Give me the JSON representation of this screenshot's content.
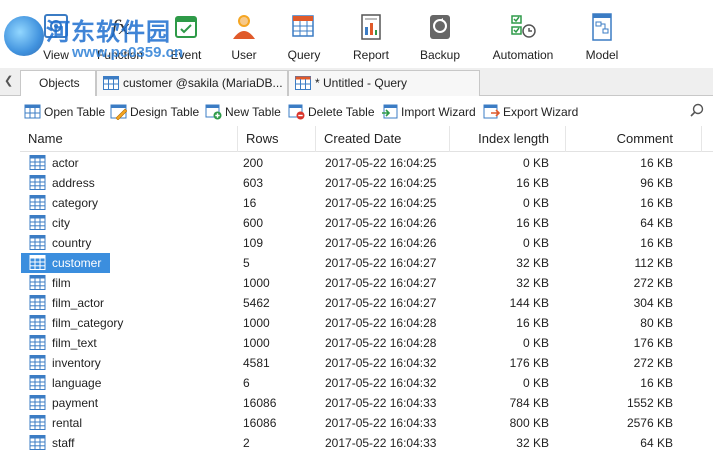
{
  "ribbon": {
    "buttons": [
      {
        "label": "View",
        "icon": "view-icon"
      },
      {
        "label": "Function",
        "icon": "function-icon"
      },
      {
        "label": "Event",
        "icon": "event-icon"
      },
      {
        "label": "User",
        "icon": "user-icon"
      },
      {
        "label": "Query",
        "icon": "query-icon"
      },
      {
        "label": "Report",
        "icon": "report-icon"
      },
      {
        "label": "Backup",
        "icon": "backup-icon"
      },
      {
        "label": "Automation",
        "icon": "automation-icon"
      },
      {
        "label": "Model",
        "icon": "model-icon"
      }
    ]
  },
  "watermark": {
    "text": "河东软件园",
    "url": "www.pc0359.cn"
  },
  "tabs": [
    {
      "label": "Objects"
    },
    {
      "label": "customer @sakila (MariaDB..."
    },
    {
      "label": "* Untitled - Query"
    }
  ],
  "toolbar": {
    "items": [
      {
        "label": "Open Table",
        "icon": "open-table-icon"
      },
      {
        "label": "Design Table",
        "icon": "design-table-icon"
      },
      {
        "label": "New Table",
        "icon": "new-table-icon"
      },
      {
        "label": "Delete Table",
        "icon": "delete-table-icon"
      },
      {
        "label": "Import Wizard",
        "icon": "import-wizard-icon"
      },
      {
        "label": "Export Wizard",
        "icon": "export-wizard-icon"
      }
    ],
    "search_icon": "search-icon"
  },
  "grid": {
    "columns": [
      "Name",
      "Rows",
      "Created Date",
      "Index length",
      "Comment"
    ],
    "selected_row": 5,
    "rows": [
      {
        "name": "actor",
        "rows": "200",
        "created": "2017-05-22 16:04:25",
        "index": "0 KB",
        "comment": "16 KB"
      },
      {
        "name": "address",
        "rows": "603",
        "created": "2017-05-22 16:04:25",
        "index": "16 KB",
        "comment": "96 KB"
      },
      {
        "name": "category",
        "rows": "16",
        "created": "2017-05-22 16:04:25",
        "index": "0 KB",
        "comment": "16 KB"
      },
      {
        "name": "city",
        "rows": "600",
        "created": "2017-05-22 16:04:26",
        "index": "16 KB",
        "comment": "64 KB"
      },
      {
        "name": "country",
        "rows": "109",
        "created": "2017-05-22 16:04:26",
        "index": "0 KB",
        "comment": "16 KB"
      },
      {
        "name": "customer",
        "rows": "5",
        "created": "2017-05-22 16:04:27",
        "index": "32 KB",
        "comment": "112 KB"
      },
      {
        "name": "film",
        "rows": "1000",
        "created": "2017-05-22 16:04:27",
        "index": "32 KB",
        "comment": "272 KB"
      },
      {
        "name": "film_actor",
        "rows": "5462",
        "created": "2017-05-22 16:04:27",
        "index": "144 KB",
        "comment": "304 KB"
      },
      {
        "name": "film_category",
        "rows": "1000",
        "created": "2017-05-22 16:04:28",
        "index": "16 KB",
        "comment": "80 KB"
      },
      {
        "name": "film_text",
        "rows": "1000",
        "created": "2017-05-22 16:04:28",
        "index": "0 KB",
        "comment": "176 KB"
      },
      {
        "name": "inventory",
        "rows": "4581",
        "created": "2017-05-22 16:04:32",
        "index": "176 KB",
        "comment": "272 KB"
      },
      {
        "name": "language",
        "rows": "6",
        "created": "2017-05-22 16:04:32",
        "index": "0 KB",
        "comment": "16 KB"
      },
      {
        "name": "payment",
        "rows": "16086",
        "created": "2017-05-22 16:04:33",
        "index": "784 KB",
        "comment": "1552 KB"
      },
      {
        "name": "rental",
        "rows": "16086",
        "created": "2017-05-22 16:04:33",
        "index": "800 KB",
        "comment": "2576 KB"
      },
      {
        "name": "staff",
        "rows": "2",
        "created": "2017-05-22 16:04:33",
        "index": "32 KB",
        "comment": "64 KB"
      }
    ]
  },
  "colors": {
    "accent": "#3b8ede",
    "table_icon": "#3b7cc4",
    "tab_bar": "#efefef"
  }
}
